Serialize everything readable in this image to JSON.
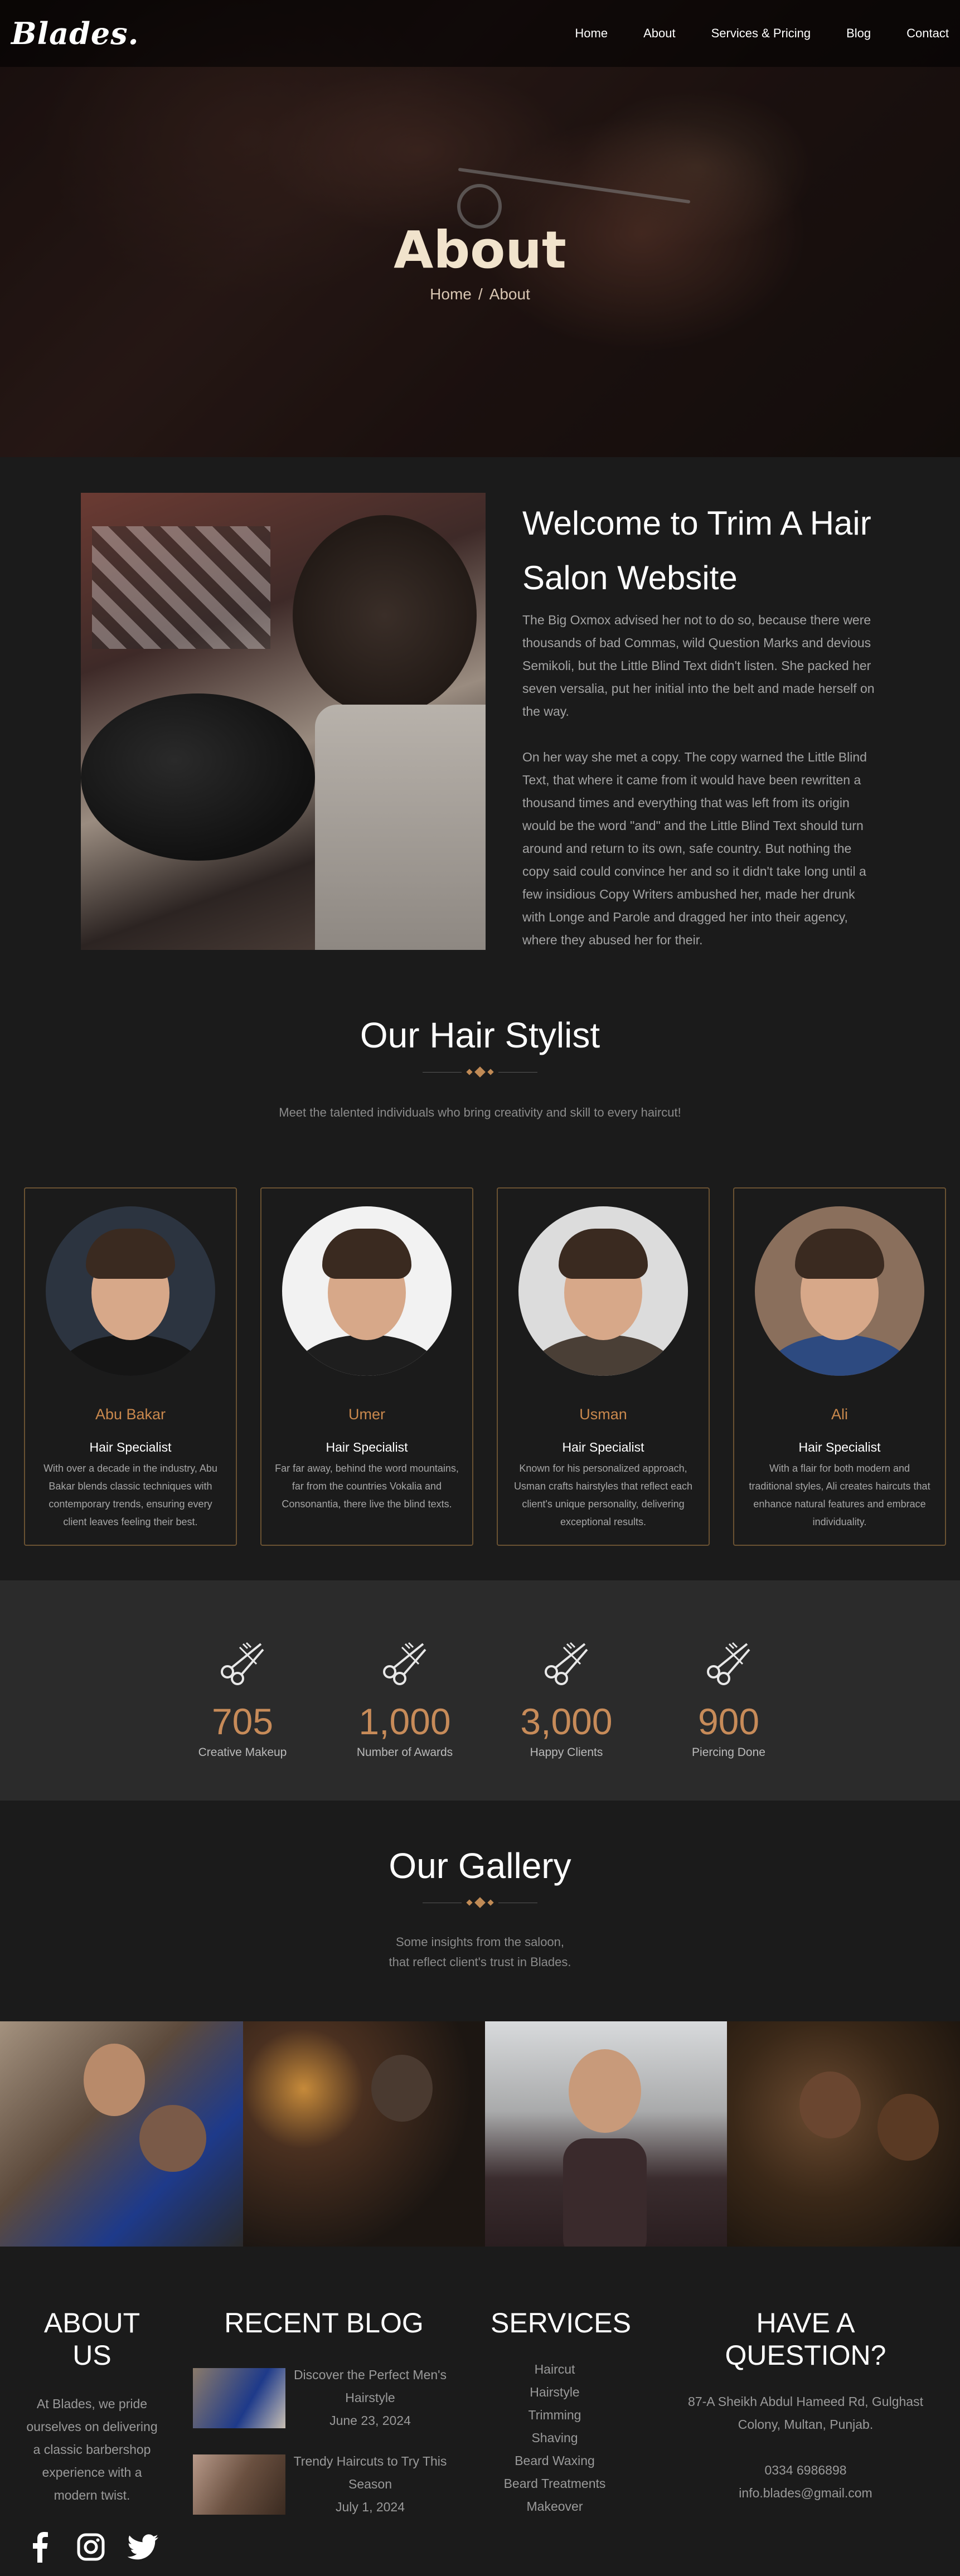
{
  "header": {
    "logo": "Blades.",
    "nav": [
      "Home",
      "About",
      "Services & Pricing",
      "Blog",
      "Contact"
    ]
  },
  "hero": {
    "title": "About",
    "breadcrumb": [
      "Home",
      "/",
      "About"
    ]
  },
  "welcome": {
    "title": "Welcome to Trim A Hair Salon Website",
    "paragraphs": [
      "The Big Oxmox advised her not to do so, because there were thousands of bad Commas, wild Question Marks and devious Semikoli, but the Little Blind Text didn't listen. She packed her seven versalia, put her initial into the belt and made herself on the way.",
      "On her way she met a copy. The copy warned the Little Blind Text, that where it came from it would have been rewritten a thousand times and everything that was left from its origin would be the word \"and\" and the Little Blind Text should turn around and return to its own, safe country. But nothing the copy said could convince her and so it didn't take long until a few insidious Copy Writers ambushed her, made her drunk with Longe and Parole and dragged her into their agency, where they abused her for their."
    ]
  },
  "stylists": {
    "title": "Our Hair Stylist",
    "subtitle": "Meet the talented individuals who bring creativity and skill to every haircut!",
    "cards": [
      {
        "name": "Abu Bakar",
        "role": "Hair Specialist",
        "desc": "With over a decade in the industry, Abu Bakar blends classic techniques with contemporary trends, ensuring every client leaves feeling their best."
      },
      {
        "name": "Umer",
        "role": "Hair Specialist",
        "desc": "Far far away, behind the word mountains, far from the countries Vokalia and Consonantia, there live the blind texts."
      },
      {
        "name": "Usman",
        "role": "Hair Specialist",
        "desc": "Known for his personalized approach, Usman crafts hairstyles that reflect each client's unique personality, delivering exceptional results."
      },
      {
        "name": "Ali",
        "role": "Hair Specialist",
        "desc": "With a flair for both modern and traditional styles, Ali creates haircuts that enhance natural features and embrace individuality."
      }
    ]
  },
  "stats": [
    {
      "value": "705",
      "label": "Creative Makeup",
      "icon": "scissors-comb-icon"
    },
    {
      "value": "1,000",
      "label": "Number of Awards",
      "icon": "scissors-comb-icon"
    },
    {
      "value": "3,000",
      "label": "Happy Clients",
      "icon": "scissors-comb-icon"
    },
    {
      "value": "900",
      "label": "Piercing Done",
      "icon": "scissors-comb-icon"
    }
  ],
  "gallery": {
    "title": "Our Gallery",
    "subtitle_line1": "Some insights from the saloon,",
    "subtitle_line2": "that reflect client's trust in Blades."
  },
  "footer": {
    "about": {
      "heading": "ABOUT US",
      "text": "At Blades, we pride ourselves on delivering a classic barbershop experience with a modern twist.",
      "socials": [
        "facebook-icon",
        "instagram-icon",
        "twitter-icon"
      ]
    },
    "blog": {
      "heading": "RECENT BLOG",
      "posts": [
        {
          "title": "Discover the Perfect Men's Hairstyle",
          "date": "June 23, 2024"
        },
        {
          "title": "Trendy Haircuts to Try This Season",
          "date": "July 1, 2024"
        }
      ]
    },
    "services": {
      "heading": "SERVICES",
      "items": [
        "Haircut",
        "Hairstyle",
        "Trimming",
        "Shaving",
        "Beard Waxing",
        "Beard Treatments",
        "Makeover"
      ]
    },
    "contact": {
      "heading": "HAVE A QUESTION?",
      "address": "87-A Sheikh Abdul Hameed Rd, Gulghast Colony, Multan, Punjab.",
      "phone": "0334 6986898",
      "email": "info.blades@gmail.com"
    }
  },
  "colors": {
    "accent": "#c78b59",
    "background": "#1b1b1b",
    "stats_background": "#2b2b2b"
  }
}
